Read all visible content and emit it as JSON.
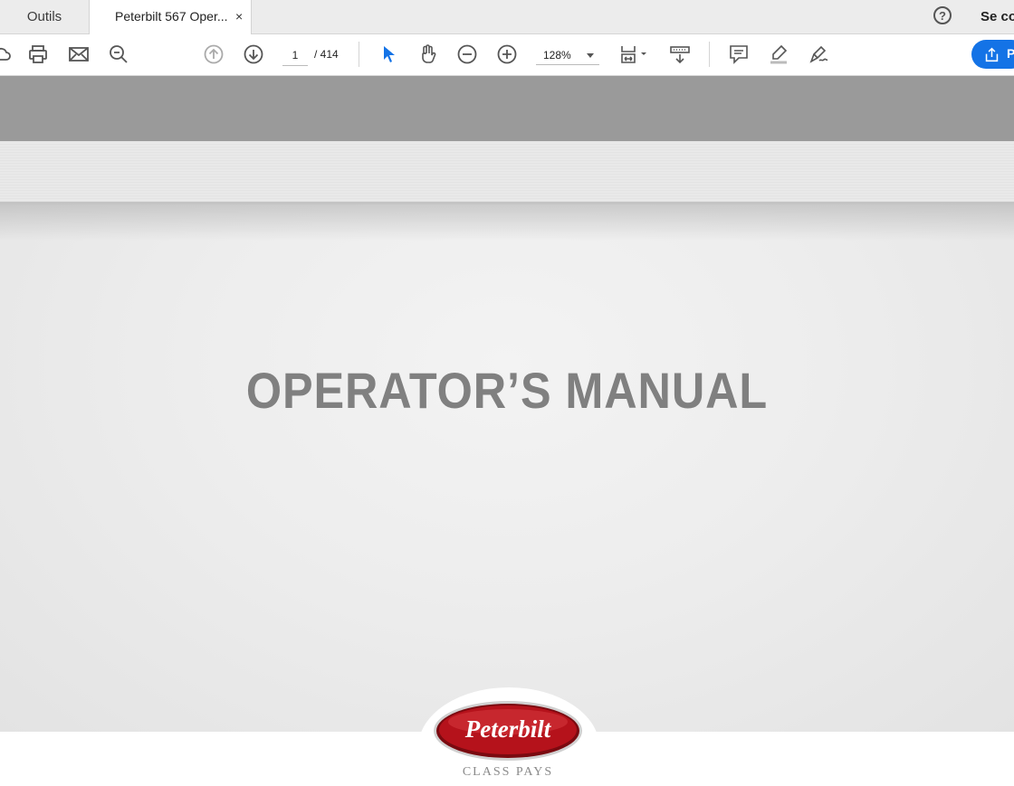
{
  "tabs": {
    "tools_label": "Outils",
    "document_title": "Peterbilt 567 Oper...",
    "close_glyph": "×"
  },
  "header": {
    "help_glyph": "?",
    "signin_label": "Se co"
  },
  "toolbar": {
    "page_current": "1",
    "page_total": "/ 414",
    "zoom_level": "128%",
    "share_label": "P",
    "icons": [
      "cloud-icon",
      "print-icon",
      "email-icon",
      "search-zoom-icon",
      "page-up-icon",
      "page-down-icon",
      "select-arrow-icon",
      "hand-icon",
      "zoom-out-icon",
      "zoom-in-icon",
      "fit-page-icon",
      "scroll-mode-icon",
      "comment-icon",
      "highlight-icon",
      "sign-icon",
      "share-icon"
    ],
    "accent_color": "#1473e6"
  },
  "document": {
    "title": "OPERATOR’S MANUAL",
    "logo_text": "Peterbilt",
    "tagline": "CLASS PAYS",
    "logo_color": "#b5121b"
  }
}
